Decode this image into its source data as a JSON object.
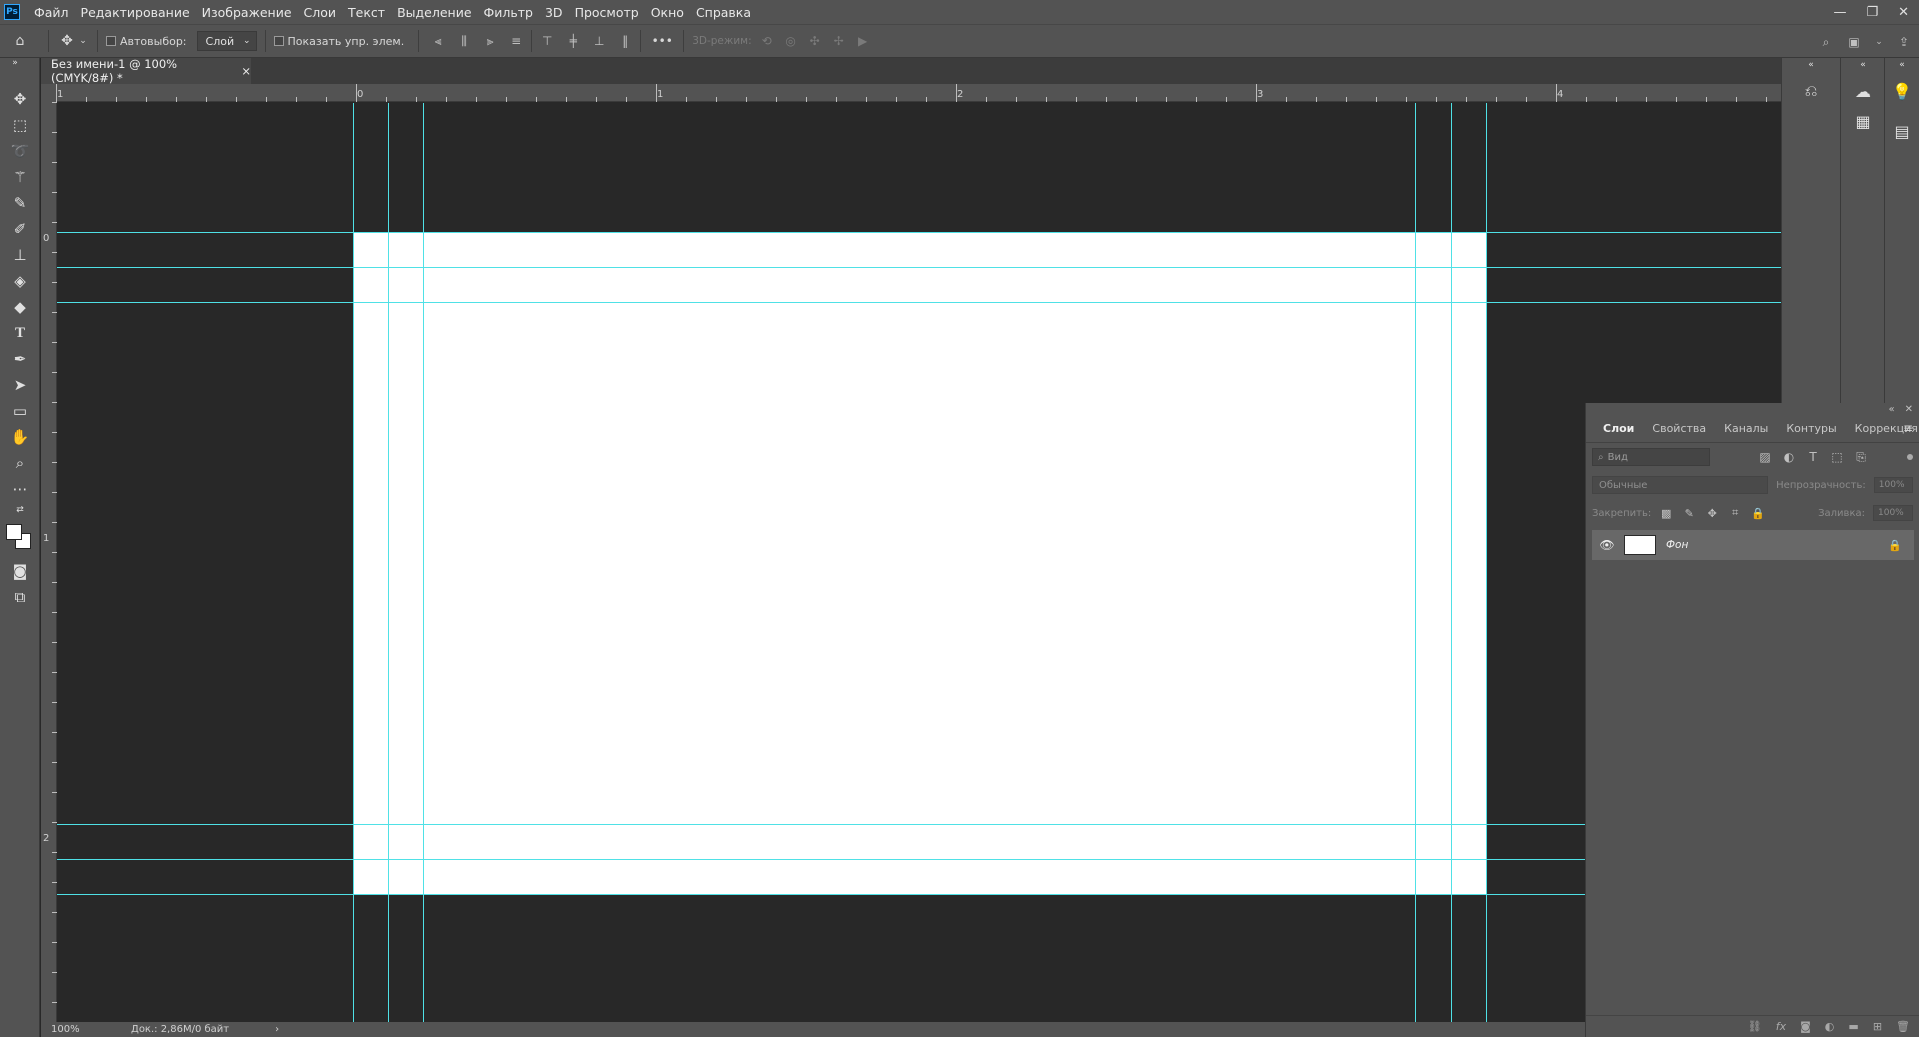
{
  "app": {
    "logo": "Ps"
  },
  "menu": [
    "Файл",
    "Редактирование",
    "Изображение",
    "Слои",
    "Текст",
    "Выделение",
    "Фильтр",
    "3D",
    "Просмотр",
    "Окно",
    "Справка"
  ],
  "window_controls": {
    "minimize": "—",
    "restore": "❐",
    "close": "✕"
  },
  "options": {
    "autoselect_label": "Автовыбор:",
    "autoselect_value": "Слой",
    "show_transform_label": "Показать упр. элем.",
    "more": "•••",
    "mode_3d_label": "3D-режим:"
  },
  "document": {
    "tab_title": "Без имени-1 @ 100% (CMYK/8#) *",
    "tab_close": "×"
  },
  "ruler_h_labels": [
    "1",
    "0",
    "1",
    "2",
    "3",
    "4"
  ],
  "ruler_v_labels": [
    "0",
    "1",
    "2"
  ],
  "status": {
    "zoom": "100%",
    "doc_info": "Док.: 2,86M/0 байт",
    "arrow": "›"
  },
  "layers_panel": {
    "tabs": [
      "Слои",
      "Свойства",
      "Каналы",
      "Контуры",
      "Коррекция"
    ],
    "active_tab": 0,
    "search_placeholder": "Вид",
    "blend_mode": "Обычные",
    "opacity_label": "Непрозрачность:",
    "opacity_value": "100%",
    "lock_label": "Закрепить:",
    "fill_label": "Заливка:",
    "fill_value": "100%",
    "layer": {
      "name": "Фон",
      "visible": true,
      "locked": true
    }
  },
  "colors": {
    "guide": "#4fe1e6",
    "ui_panel": "#535353",
    "pasteboard": "#282828",
    "document": "#ffffff"
  }
}
